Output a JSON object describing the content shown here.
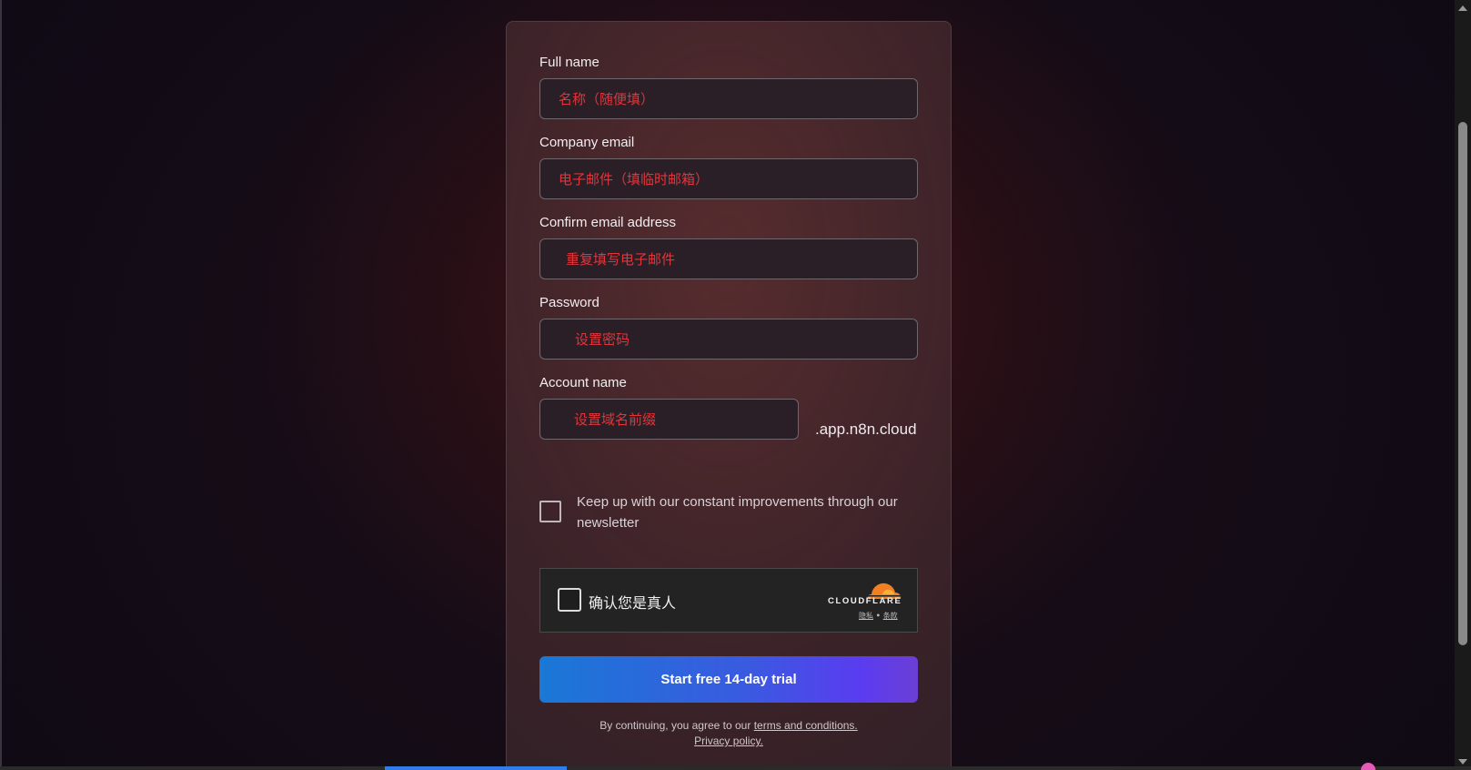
{
  "form": {
    "full_name": {
      "label": "Full name",
      "placeholder": "名称（随便填）"
    },
    "company_email": {
      "label": "Company email",
      "placeholder": "电子邮件（填临时邮箱）"
    },
    "confirm_email": {
      "label": "Confirm email address",
      "placeholder": "重复填写电子邮件"
    },
    "password": {
      "label": "Password",
      "placeholder": "设置密码"
    },
    "account_name": {
      "label": "Account name",
      "placeholder": "设置域名前缀",
      "suffix": ".app.n8n.cloud"
    },
    "newsletter": {
      "label": "Keep up with our constant improvements through our newsletter",
      "checked": false
    },
    "submit_label": "Start free 14-day trial",
    "legal": {
      "prefix": "By continuing, you agree to our ",
      "terms_link": "terms and conditions.",
      "privacy_link": "Privacy policy."
    }
  },
  "captcha": {
    "label": "确认您是真人",
    "brand": "CLOUDFLARE",
    "privacy_link": "隐私",
    "separator": " • ",
    "terms_link": "条款",
    "brand_icon": "cloudflare-cloud-icon"
  },
  "colors": {
    "placeholder_red": "#e0353a",
    "cta_gradient_start": "#1a78d6",
    "cta_gradient_end": "#5a3cf0",
    "cloudflare_orange": "#f38020"
  }
}
